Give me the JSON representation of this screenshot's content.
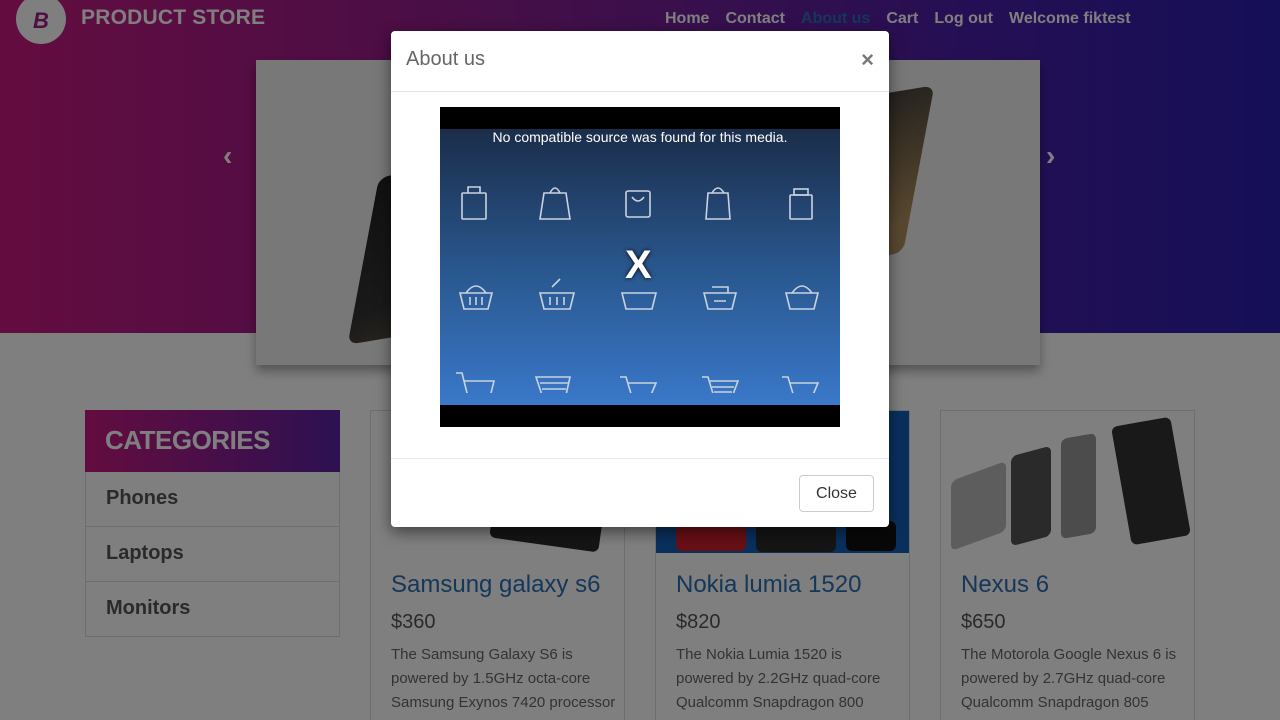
{
  "header": {
    "logo_letter": "B",
    "brand": "PRODUCT STORE",
    "nav": [
      {
        "label": "Home",
        "active": false
      },
      {
        "label": "Contact",
        "active": false
      },
      {
        "label": "About us",
        "active": true
      },
      {
        "label": "Cart",
        "active": false
      },
      {
        "label": "Log out",
        "active": false
      },
      {
        "label": "Welcome fiktest",
        "active": false
      }
    ]
  },
  "carousel": {
    "prev_icon": "‹",
    "next_icon": "›"
  },
  "categories": {
    "title": "CATEGORIES",
    "items": [
      "Phones",
      "Laptops",
      "Monitors"
    ]
  },
  "products": [
    {
      "title": "Samsung galaxy s6",
      "price": "$360",
      "desc": "The Samsung Galaxy S6 is powered by 1.5GHz octa-core Samsung Exynos 7420 processor"
    },
    {
      "title": "Nokia lumia 1520",
      "price": "$820",
      "desc": "The Nokia Lumia 1520 is powered by 2.2GHz quad-core Qualcomm Snapdragon 800"
    },
    {
      "title": "Nexus 6",
      "price": "$650",
      "desc": "The Motorola Google Nexus 6 is powered by 2.7GHz quad-core Qualcomm Snapdragon 805"
    }
  ],
  "modal": {
    "title": "About us",
    "close_x": "×",
    "video_message": "No compatible source was found for this media.",
    "video_error_mark": "X",
    "close_button": "Close"
  },
  "colors": {
    "brand_gradient_start": "#c8197f",
    "brand_gradient_end": "#2a1fb0",
    "link_blue": "#2a6fb5"
  }
}
